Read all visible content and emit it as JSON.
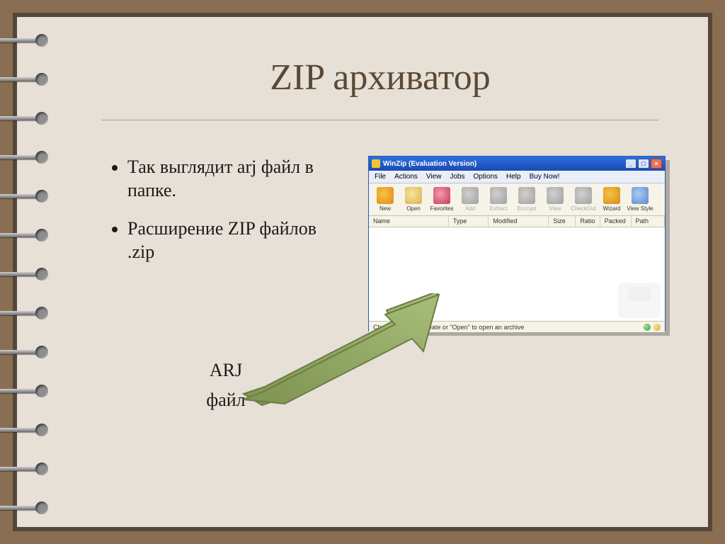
{
  "slide": {
    "title": "ZIP архиватор",
    "bullets": [
      "Так выглядит arj файл в папке.",
      "Расширение ZIP файлов .zip"
    ],
    "sub_label_line1": "ARJ",
    "sub_label_line2": "файл"
  },
  "winzip": {
    "title": "WinZip (Evaluation Version)",
    "menu": [
      "File",
      "Actions",
      "View",
      "Jobs",
      "Options",
      "Help",
      "Buy Now!"
    ],
    "toolbar": [
      {
        "key": "new",
        "label": "New",
        "enabled": true
      },
      {
        "key": "open",
        "label": "Open",
        "enabled": true
      },
      {
        "key": "fav",
        "label": "Favorites",
        "enabled": true
      },
      {
        "key": "add",
        "label": "Add",
        "enabled": false
      },
      {
        "key": "extract",
        "label": "Extract",
        "enabled": false
      },
      {
        "key": "encrypt",
        "label": "Encrypt",
        "enabled": false
      },
      {
        "key": "view",
        "label": "View",
        "enabled": false
      },
      {
        "key": "checkout",
        "label": "CheckOut",
        "enabled": false
      },
      {
        "key": "wizard",
        "label": "Wizard",
        "enabled": true
      },
      {
        "key": "style",
        "label": "View Style",
        "enabled": true
      }
    ],
    "columns": [
      "Name",
      "Type",
      "Modified",
      "Size",
      "Ratio",
      "Packed",
      "Path"
    ],
    "status": "Choose \"New\" to create or \"Open\" to open an archive"
  }
}
